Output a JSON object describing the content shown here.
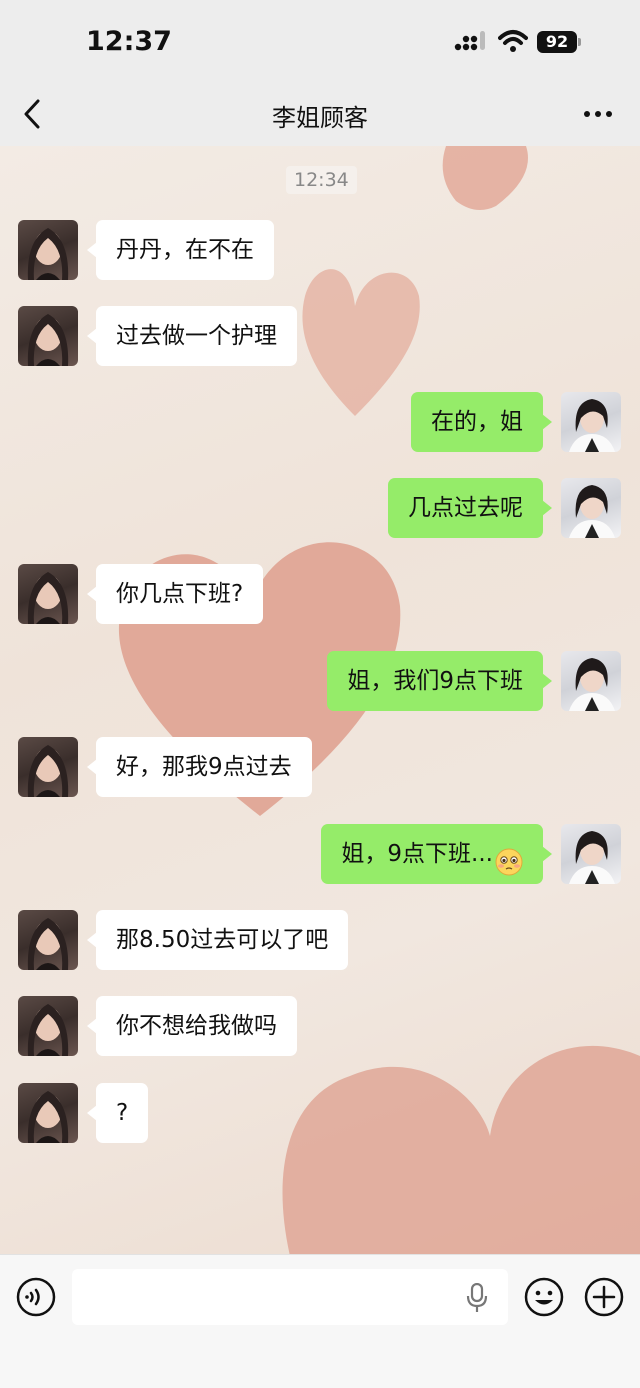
{
  "status_bar": {
    "time": "12:37",
    "battery": "92"
  },
  "nav": {
    "title": "李姐顾客"
  },
  "chat": {
    "timestamp": "12:34",
    "messages": [
      {
        "side": "left",
        "text": "丹丹，在不在"
      },
      {
        "side": "left",
        "text": "过去做一个护理"
      },
      {
        "side": "right",
        "text": "在的，姐"
      },
      {
        "side": "right",
        "text": "几点过去呢"
      },
      {
        "side": "left",
        "text": "你几点下班?"
      },
      {
        "side": "right",
        "text": "姐，我们9点下班"
      },
      {
        "side": "left",
        "text": "好，那我9点过去"
      },
      {
        "side": "right",
        "text": "姐，9点下班...",
        "emoji": "flushed-face"
      },
      {
        "side": "left",
        "text": "那8.50过去可以了吧"
      },
      {
        "side": "left",
        "text": "你不想给我做吗"
      },
      {
        "side": "left",
        "text": "?"
      }
    ]
  },
  "input_bar": {
    "value": "",
    "placeholder": ""
  },
  "colors": {
    "sent_bubble": "#95ec69",
    "received_bubble": "#ffffff",
    "bar_background": "#ededed"
  }
}
